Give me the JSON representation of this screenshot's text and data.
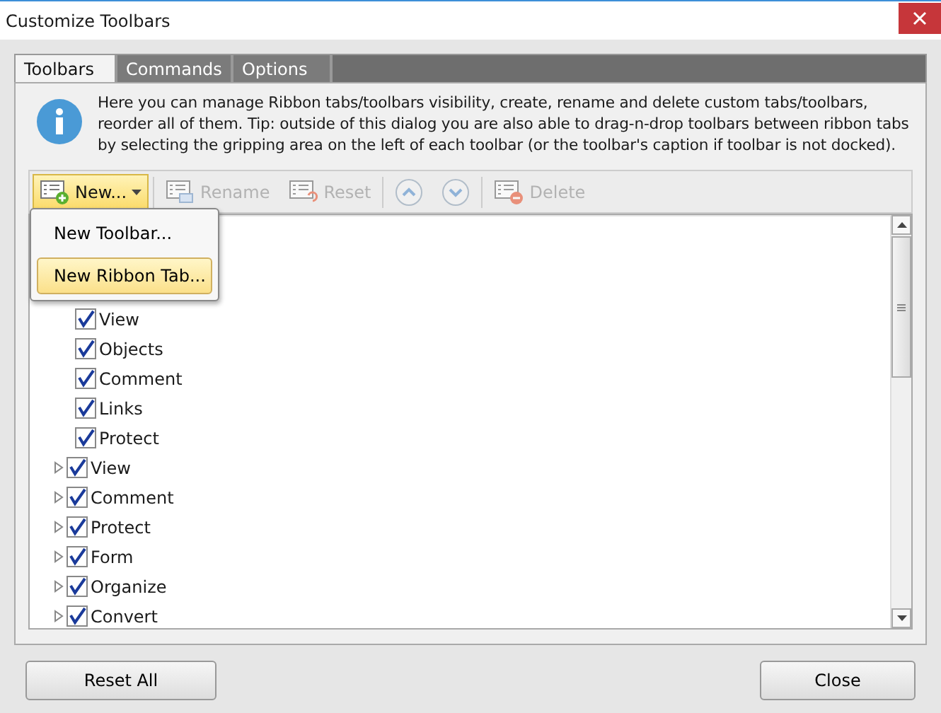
{
  "window": {
    "title": "Customize Toolbars"
  },
  "tabs": [
    {
      "label": "Toolbars",
      "selected": true
    },
    {
      "label": "Commands",
      "selected": false
    },
    {
      "label": "Options",
      "selected": false
    }
  ],
  "info": "Here you can manage Ribbon tabs/toolbars visibility, create, rename and delete custom tabs/toolbars, reorder all of them. Tip: outside of this dialog you are also able to drag-n-drop toolbars between ribbon tabs by selecting the gripping area on the left of each toolbar (or the toolbar's caption if toolbar is not docked).",
  "toolbar": [
    {
      "kind": "new",
      "label": "New...",
      "disabled": false,
      "selected": true
    },
    {
      "kind": "rename",
      "label": "Rename",
      "disabled": true,
      "selected": false
    },
    {
      "kind": "reset",
      "label": "Reset",
      "disabled": true,
      "selected": false
    },
    {
      "kind": "up",
      "disabled": true,
      "selected": false
    },
    {
      "kind": "down",
      "disabled": true,
      "selected": false
    },
    {
      "kind": "delete",
      "label": "Delete",
      "disabled": true,
      "selected": false
    }
  ],
  "menu": [
    {
      "label": "New Toolbar...",
      "selected": false
    },
    {
      "label": "New Ribbon Tab...",
      "selected": true
    }
  ],
  "tree": [
    {
      "children": [
        {
          "label": "View",
          "checked": true
        },
        {
          "label": "Objects",
          "checked": true
        },
        {
          "label": "Comment",
          "checked": true
        },
        {
          "label": "Links",
          "checked": true
        },
        {
          "label": "Protect",
          "checked": true
        }
      ]
    },
    {
      "label": "View",
      "checked": true,
      "expanded": false
    },
    {
      "label": "Comment",
      "checked": true,
      "expanded": false
    },
    {
      "label": "Protect",
      "checked": true,
      "expanded": false
    },
    {
      "label": "Form",
      "checked": true,
      "expanded": false
    },
    {
      "label": "Organize",
      "checked": true,
      "expanded": false
    },
    {
      "label": "Convert",
      "checked": true,
      "expanded": false
    }
  ],
  "buttons": [
    "Reset All",
    "Close"
  ]
}
